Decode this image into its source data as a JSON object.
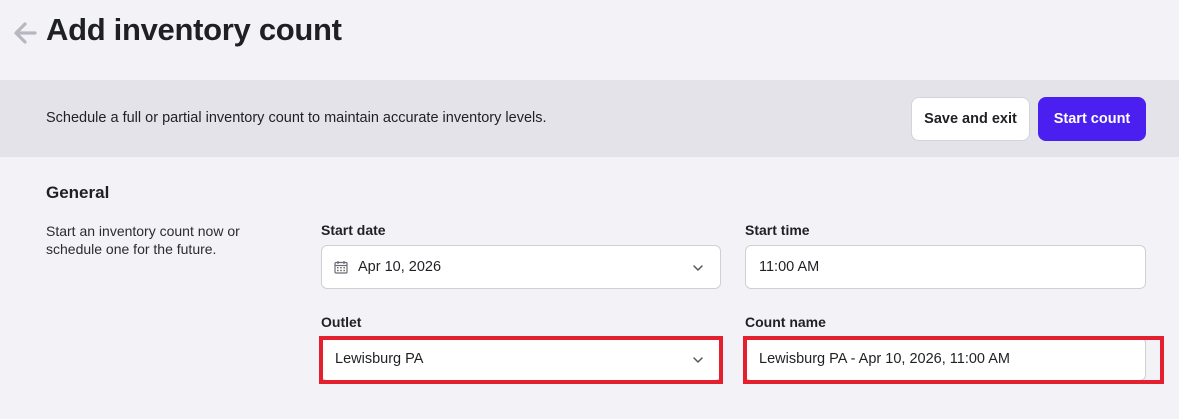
{
  "header": {
    "title": "Add inventory count",
    "back_icon": "arrow-left-icon"
  },
  "banner": {
    "description": "Schedule a full or partial inventory count to maintain accurate inventory levels.",
    "save_exit_label": "Save and exit",
    "start_count_label": "Start count"
  },
  "general": {
    "title": "General",
    "description": "Start an inventory count now or schedule one for the future.",
    "start_date": {
      "label": "Start date",
      "value": "Apr 10, 2026",
      "icon": "calendar-icon"
    },
    "start_time": {
      "label": "Start time",
      "value": "11:00 AM"
    },
    "outlet": {
      "label": "Outlet",
      "value": "Lewisburg PA"
    },
    "count_name": {
      "label": "Count name",
      "value": "Lewisburg PA - Apr 10, 2026, 11:00 AM"
    }
  },
  "colors": {
    "primary": "#4b1ff0",
    "highlight": "#e5202e",
    "background": "#f3f3f7",
    "banner": "#e3e3e9"
  }
}
